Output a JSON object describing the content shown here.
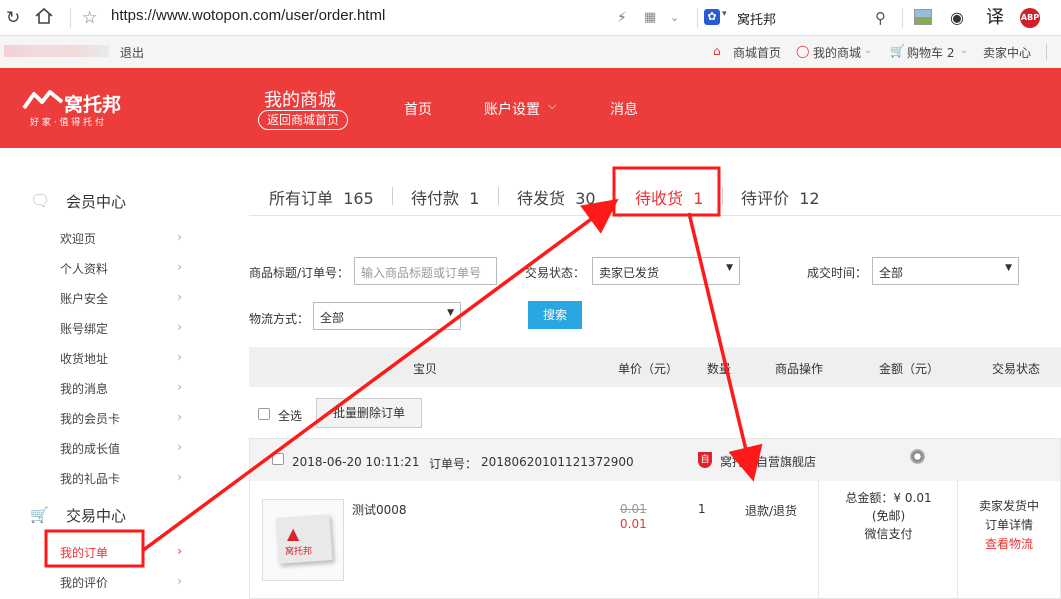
{
  "browser": {
    "url": "https://www.wotopon.com/user/order.html",
    "ext_label": "窝托邦",
    "translate_glyph": "译",
    "abp_label": "ABP"
  },
  "topbar": {
    "logout": "退出",
    "mall_home": "商城首页",
    "my_mall": "我的商城",
    "cart": "购物车 2",
    "seller": "卖家中心"
  },
  "header": {
    "logo_text": "窝托邦",
    "logo_slogan": "好 家 · 值 得 托 付",
    "title": "我的商城",
    "back_link": "返回商城首页",
    "nav": [
      "首页",
      "账户设置",
      "消息"
    ]
  },
  "sidebar": {
    "member_title": "会员中心",
    "member_items": [
      "欢迎页",
      "个人资料",
      "账户安全",
      "账号绑定",
      "收货地址",
      "我的消息",
      "我的会员卡",
      "我的成长值",
      "我的礼品卡"
    ],
    "trade_title": "交易中心",
    "trade_items": [
      "我的订单",
      "我的评价"
    ]
  },
  "tabs": [
    {
      "label": "所有订单",
      "count": "165"
    },
    {
      "label": "待付款",
      "count": "1"
    },
    {
      "label": "待发货",
      "count": "30"
    },
    {
      "label": "待收货",
      "count": "1"
    },
    {
      "label": "待评价",
      "count": "12"
    }
  ],
  "filters": {
    "title_label": "商品标题/订单号：",
    "title_placeholder": "输入商品标题或订单号",
    "status_label": "交易状态：",
    "status_value": "卖家已发货",
    "time_label": "成交时间：",
    "time_value": "全部",
    "ship_label": "物流方式：",
    "ship_value": "全部",
    "search_btn": "搜索"
  },
  "table_head": [
    "宝贝",
    "单价（元）",
    "数量",
    "商品操作",
    "金额（元）",
    "交易状态"
  ],
  "bulk": {
    "select_all": "全选",
    "delete_btn": "批量删除订单"
  },
  "order": {
    "date": "2018-06-20 10:11:21",
    "order_label": "订单号：",
    "order_no": "20180620101121372900",
    "shop": "窝托邦自营旗舰店",
    "shop_badge": "自",
    "product_name": "测试0008",
    "thumb_text": "窝托邦",
    "old_price": "0.01",
    "price": "0.01",
    "qty": "1",
    "action": "退款/退货",
    "total_label": "总金额：",
    "total": "¥ 0.01",
    "shipping_note": "(免邮)",
    "payment": "微信支付",
    "status": "卖家发货中",
    "detail_link": "订单详情",
    "logistics_link": "查看物流"
  },
  "colors": {
    "brand_red": "#ed3c3c",
    "annotation_red": "#ff1a1a",
    "search_blue": "#2aa6e0"
  }
}
